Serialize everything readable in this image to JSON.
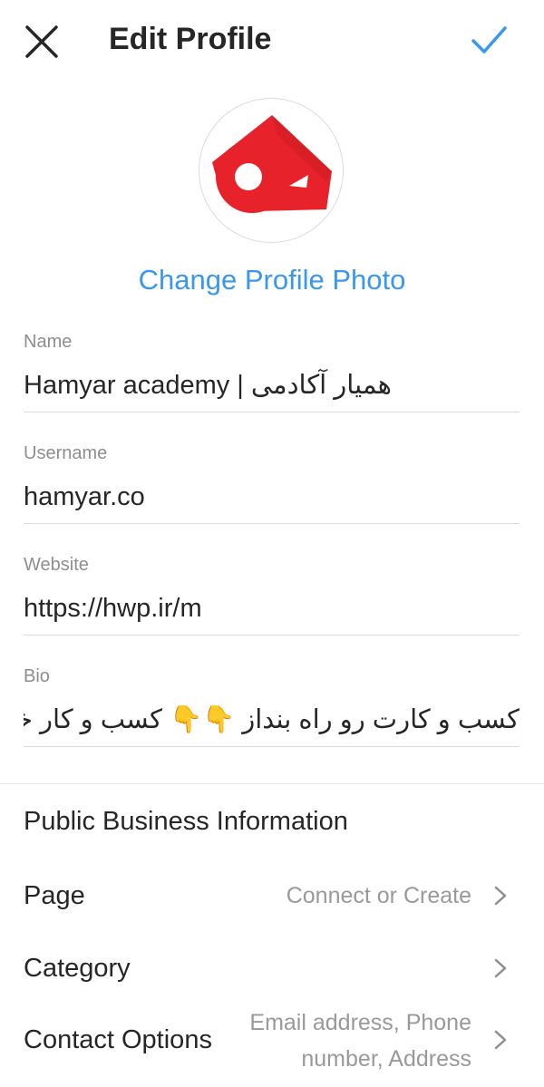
{
  "header": {
    "title": "Edit Profile",
    "close_icon": "close-icon",
    "done_icon": "checkmark-icon"
  },
  "profile": {
    "avatar_icon": "hamyar-logo",
    "change_photo_label": "Change Profile Photo"
  },
  "fields": {
    "name": {
      "label": "Name",
      "value": "Hamyar academy | همیار آکادمی"
    },
    "username": {
      "label": "Username",
      "value": "hamyar.co"
    },
    "website": {
      "label": "Website",
      "value": "https://hwp.ir/m"
    },
    "bio": {
      "label": "Bio",
      "value": "کسب و کارت رو راه بنداز 👇👇 کسب و کار خودت رو شروع کنی"
    }
  },
  "business": {
    "section_title": "Public Business Information",
    "page": {
      "label": "Page",
      "value": "Connect or Create"
    },
    "category": {
      "label": "Category",
      "value": ""
    },
    "contact": {
      "label": "Contact Options",
      "value_line1": "Email address, Phone",
      "value_line2": "number, Address"
    }
  },
  "colors": {
    "accent": "#3897f0",
    "logo_red": "#e8222a",
    "text": "#262626",
    "muted": "#8e8e8e"
  }
}
